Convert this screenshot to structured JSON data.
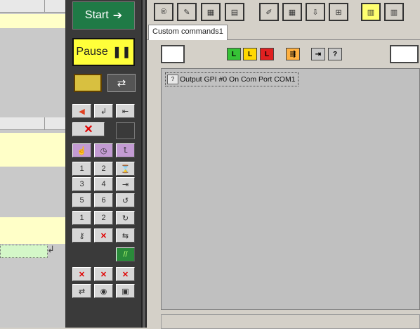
{
  "center": {
    "start_label": "Start",
    "start_arrow": "➔",
    "pause_label": "Pause",
    "pause_icon": "❚❚",
    "tools": [
      {
        "icon": "arrow-left-icon",
        "glyph": "◀"
      },
      {
        "icon": "return-icon",
        "glyph": "↲"
      },
      {
        "icon": "step-back-icon",
        "glyph": "⇤"
      },
      {
        "icon": "delete-x-icon",
        "glyph": "✕"
      },
      {
        "icon": "hand-icon",
        "glyph": "☝"
      },
      {
        "icon": "clock-icon",
        "glyph": "◷"
      },
      {
        "icon": "turn-up-icon",
        "glyph": "⮤"
      },
      {
        "icon": "timer-1-icon",
        "glyph": "1"
      },
      {
        "icon": "timer-2-icon",
        "glyph": "2"
      },
      {
        "icon": "hourglass-icon",
        "glyph": "⌛"
      },
      {
        "icon": "timer-3-icon",
        "glyph": "3"
      },
      {
        "icon": "timer-4-icon",
        "glyph": "4"
      },
      {
        "icon": "jump-icon",
        "glyph": "⇥"
      },
      {
        "icon": "timer-5-icon",
        "glyph": "5"
      },
      {
        "icon": "timer-6-icon",
        "glyph": "6"
      },
      {
        "icon": "loop-5-icon",
        "glyph": "↺"
      },
      {
        "icon": "edit-1-icon",
        "glyph": "1"
      },
      {
        "icon": "edit-2-icon",
        "glyph": "2"
      },
      {
        "icon": "loop-icon",
        "glyph": "↻"
      },
      {
        "icon": "key-icon",
        "glyph": "⚷"
      },
      {
        "icon": "key-x-icon",
        "glyph": "✕"
      },
      {
        "icon": "split-arrows-icon",
        "glyph": "⇆"
      },
      {
        "icon": "delete-row-icon",
        "glyph": "✕"
      },
      {
        "icon": "delete-up-icon",
        "glyph": "✕"
      },
      {
        "icon": "delete-all-icon",
        "glyph": "✕"
      },
      {
        "icon": "shuffle-icon",
        "glyph": "⇄"
      },
      {
        "icon": "gauge-icon",
        "glyph": "◉"
      },
      {
        "icon": "save-icon",
        "glyph": "▣"
      }
    ]
  },
  "toolbar": {
    "buttons": [
      {
        "icon": "r-badge-icon",
        "glyph": "®"
      },
      {
        "icon": "edit-icon",
        "glyph": "✎"
      },
      {
        "icon": "film-icon",
        "glyph": "▦"
      },
      {
        "icon": "table-icon",
        "glyph": "▤"
      },
      {
        "icon": "paint-icon",
        "glyph": "✐"
      },
      {
        "icon": "grid-icon",
        "glyph": "▦"
      },
      {
        "icon": "import-icon",
        "glyph": "⇩"
      },
      {
        "icon": "network-icon",
        "glyph": "⊞"
      },
      {
        "icon": "doc-icon",
        "glyph": "▥"
      },
      {
        "icon": "doc2-icon",
        "glyph": "▥"
      }
    ],
    "small": [
      {
        "icon": "green-l-icon",
        "label": "L",
        "color": "#36c236"
      },
      {
        "icon": "yellow-l-icon",
        "label": "L",
        "color": "#ffd800"
      },
      {
        "icon": "red-l-icon",
        "label": "L",
        "color": "#e02020"
      },
      {
        "icon": "export-icon",
        "label": "⇶",
        "color": "#ffb040"
      },
      {
        "icon": "forward-icon",
        "label": "⇥",
        "color": "#c8c8c8"
      },
      {
        "icon": "query-forward-icon",
        "label": "?",
        "color": "#c8c8c8"
      }
    ]
  },
  "tab_label": "Custom commands1",
  "command": {
    "icon": "query-command-icon",
    "glyph": "?",
    "text": "Output GPI #0 On Com Port COM1"
  }
}
